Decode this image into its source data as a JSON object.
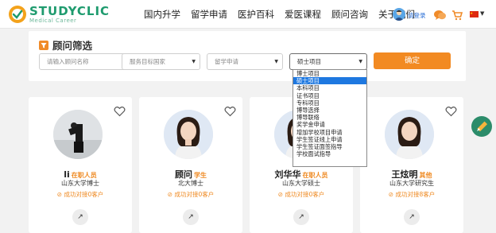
{
  "brand": {
    "name": "STUDYCLIC",
    "tagline": "Medical Career"
  },
  "nav": {
    "items": [
      "国内升学",
      "留学申请",
      "医护百科",
      "爱医课程",
      "顾问咨询",
      "关于我们"
    ]
  },
  "header": {
    "login_label": "请登录"
  },
  "icons": [
    "user-avatar-icon",
    "chat-icon",
    "cart-icon",
    "china-flag-icon",
    "filter-icon",
    "heart-icon",
    "arrow-up-right-icon",
    "pencil-icon",
    "check-circle-icon"
  ],
  "colors": {
    "brand_green": "#1e9b6e",
    "accent_orange": "#f28a22",
    "selected_blue": "#1e78e0"
  },
  "filter": {
    "title": "顾问筛选",
    "name_placeholder": "请输入顾问名称",
    "country_value": "服务目标国家",
    "service_value": "留学申请",
    "project_value": "硕士项目",
    "confirm_label": "确定"
  },
  "project_options": [
    "博士项目",
    "硕士项目",
    "本科项目",
    "证书项目",
    "专科项目",
    "博导选择",
    "博导联络",
    "奖学金申请",
    "增加学校项目申请",
    "学生签证线上申请",
    "学生签证面签指导",
    "学校面试指导"
  ],
  "selected_option": "硕士项目",
  "cards": [
    {
      "name": "li",
      "role": "在职人员",
      "school": "山东大学博士",
      "success": "成功对接0客户"
    },
    {
      "name": "顾问",
      "role": "学生",
      "school": "北大博士",
      "success": "成功对接0客户"
    },
    {
      "name": "刘华华",
      "role": "在职人员",
      "school": "山东大学硕士",
      "success": "成功对接0客户"
    },
    {
      "name": "王炫明",
      "role": "其他",
      "school": "山东大学研究生",
      "success": "成功对接8客户"
    }
  ]
}
